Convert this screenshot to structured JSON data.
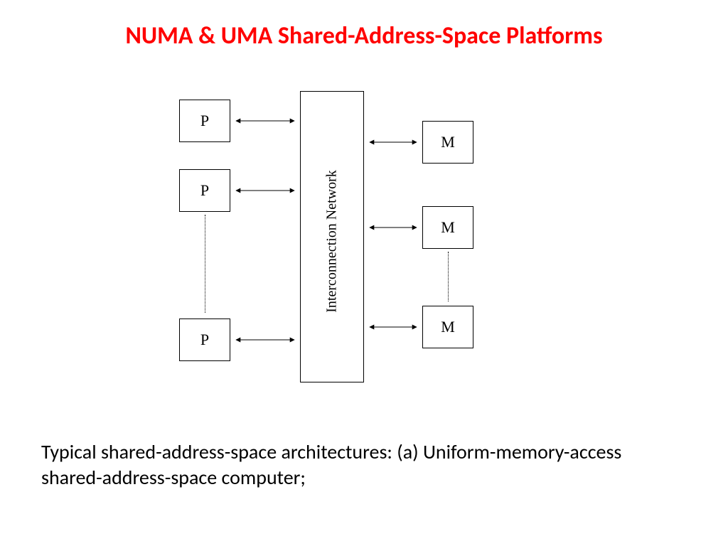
{
  "title": "NUMA & UMA Shared-Address-Space Platforms",
  "caption": "Typical shared-address-space architectures: (a)  Uniform-memory-access shared-address-space computer;",
  "network_label": "Interconnection Network",
  "processors": [
    "P",
    "P",
    "P"
  ],
  "memories": [
    "M",
    "M",
    "M"
  ],
  "colors": {
    "title": "#ff0000",
    "line": "#000000"
  }
}
